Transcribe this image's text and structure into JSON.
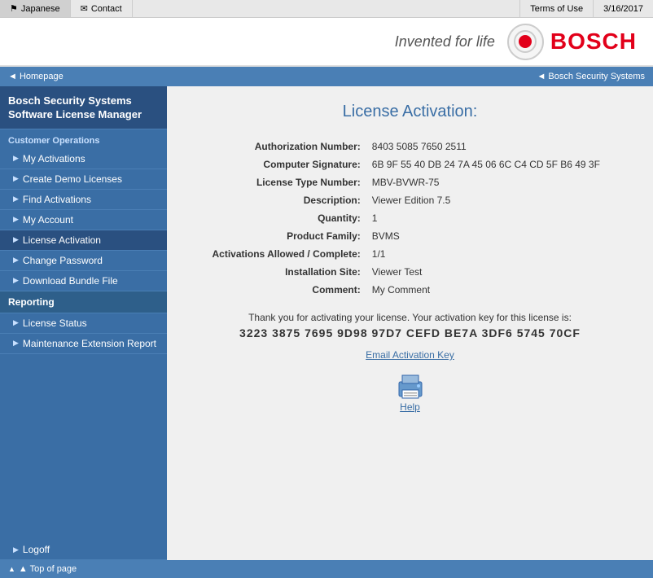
{
  "topbar": {
    "japanese_label": "Japanese",
    "contact_label": "Contact",
    "terms_label": "Terms of Use",
    "date": "3/16/2017",
    "contact_icon": "✉",
    "flag_icon": "⚑"
  },
  "logobar": {
    "tagline": "Invented for life",
    "brand": "BOSCH"
  },
  "breadcrumb": {
    "homepage": "◄ Homepage",
    "section": "◄ Bosch Security Systems"
  },
  "sidebar": {
    "brand_line1": "Bosch Security Systems",
    "brand_line2": "Software License Manager",
    "customer_ops_label": "Customer Operations",
    "items": [
      {
        "label": "My Activations",
        "arrow": "▶"
      },
      {
        "label": "Create Demo Licenses",
        "arrow": "▶"
      },
      {
        "label": "Find Activations",
        "arrow": "▶"
      },
      {
        "label": "My Account",
        "arrow": "▶"
      },
      {
        "label": "License Activation",
        "arrow": "▶"
      },
      {
        "label": "Change Password",
        "arrow": "▶"
      },
      {
        "label": "Download Bundle File",
        "arrow": "▶"
      }
    ],
    "reporting_label": "Reporting",
    "reporting_items": [
      {
        "label": "License Status",
        "arrow": "▶"
      },
      {
        "label": "Maintenance Extension Report",
        "arrow": "▶"
      }
    ],
    "logoff_label": "Logoff",
    "logoff_arrow": "▶",
    "bottom_label": "▲ Top of page"
  },
  "content": {
    "title": "License Activation:",
    "fields": [
      {
        "label": "Authorization Number:",
        "value": "8403 5085 7650 2511"
      },
      {
        "label": "Computer Signature:",
        "value": "6B 9F 55 40 DB 24 7A 45 06 6C C4 CD 5F B6 49 3F"
      },
      {
        "label": "License Type Number:",
        "value": "MBV-BVWR-75"
      },
      {
        "label": "Description:",
        "value": "Viewer Edition 7.5"
      },
      {
        "label": "Quantity:",
        "value": "1"
      },
      {
        "label": "Product Family:",
        "value": "BVMS"
      },
      {
        "label": "Activations Allowed / Complete:",
        "value": "1/1"
      },
      {
        "label": "Installation Site:",
        "value": "Viewer Test"
      },
      {
        "label": "Comment:",
        "value": "My Comment"
      }
    ],
    "activation_message": "Thank you for activating your license. Your activation key for this license is:",
    "activation_key": "3223 3875 7695 9D98 97D7 CEFD BE7A 3DF6 5745 70CF",
    "email_link": "Email Activation Key",
    "help_label": "Help"
  }
}
